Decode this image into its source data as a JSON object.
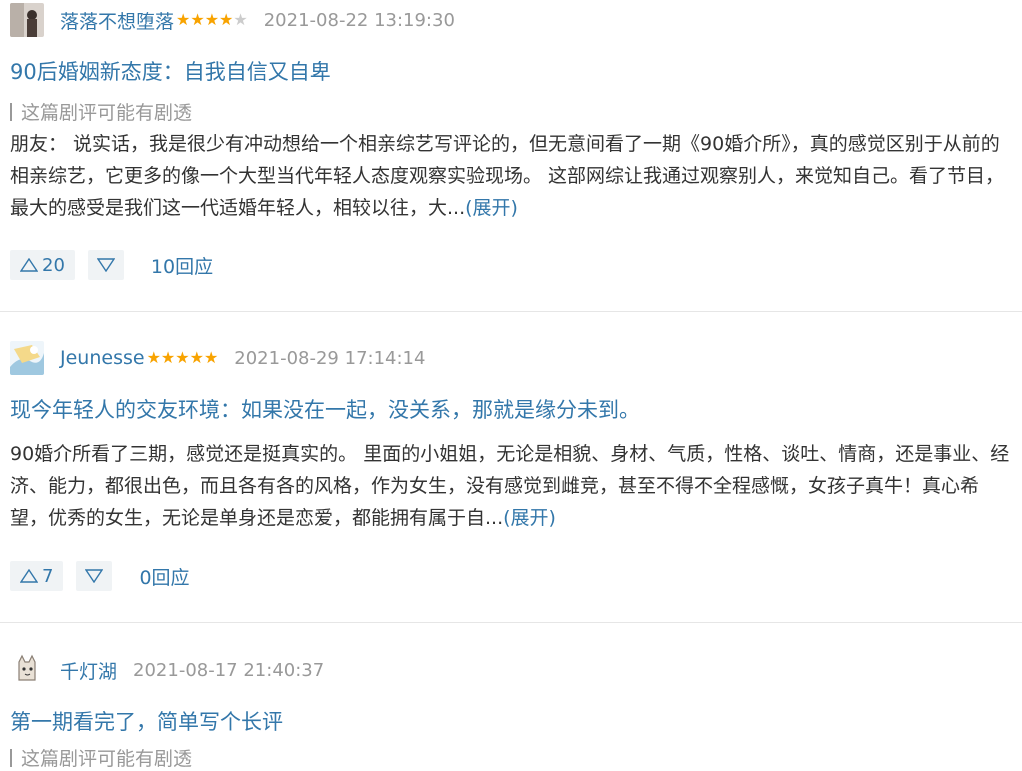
{
  "reviews": [
    {
      "author": "落落不想堕落",
      "rating": 4,
      "time": "2021-08-22 13:19:30",
      "title": "90后婚姻新态度：自我自信又自卑",
      "spoiler": "这篇剧评可能有剧透",
      "body": "朋友： 说实话，我是很少有冲动想给一个相亲综艺写评论的，但无意间看了一期《90婚介所》，真的感觉区别于从前的相亲综艺，它更多的像一个大型当代年轻人态度观察实验现场。 这部网综让我通过观察别人，来觉知自己。看了节目，最大的感受是我们这一代适婚年轻人，相较以往，大...",
      "expand_label": "(展开)",
      "upvotes": "20",
      "replies": "10回应"
    },
    {
      "author": "Jeunesse",
      "rating": 5,
      "time": "2021-08-29 17:14:14",
      "title": "现今年轻人的交友环境：如果没在一起，没关系，那就是缘分未到。",
      "body": "90婚介所看了三期，感觉还是挺真实的。 里面的小姐姐，无论是相貌、身材、气质，性格、谈吐、情商，还是事业、经济、能力，都很出色，而且各有各的风格，作为女生，没有感觉到雌竞，甚至不得不全程感慨，女孩子真牛！真心希望，优秀的女生，无论是单身还是恋爱，都能拥有属于自...",
      "expand_label": "(展开)",
      "upvotes": "7",
      "replies": "0回应"
    },
    {
      "author": "千灯湖",
      "rating": 0,
      "time": "2021-08-17 21:40:37",
      "title": "第一期看完了，简单写个长评",
      "spoiler": "这篇剧评可能有剧透"
    }
  ],
  "icons": {
    "upvote": "triangle-up-outline-icon",
    "downvote": "triangle-down-outline-icon"
  },
  "colors": {
    "link": "#3377aa",
    "star": "#f8a300",
    "vote_bg": "#f0f3f5"
  }
}
